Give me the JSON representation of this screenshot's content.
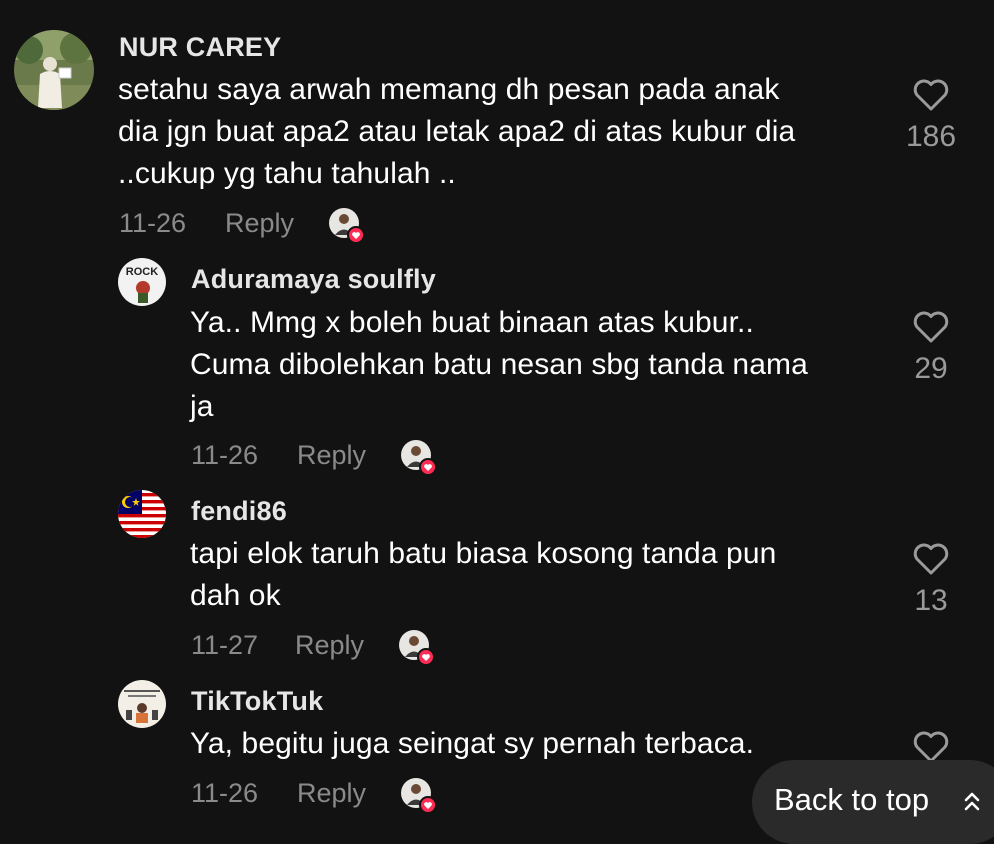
{
  "comments": [
    {
      "username": "NUR CAREY",
      "text_lines": [
        "setahu saya arwah memang dh pesan pada anak",
        "dia jgn buat apa2 atau letak apa2 di atas kubur dia",
        "..cukup yg tahu tahulah .."
      ],
      "date": "11-26",
      "reply_label": "Reply",
      "likes": "186"
    },
    {
      "username": "Aduramaya soulfly",
      "text_lines": [
        "Ya.. Mmg x boleh buat binaan atas kubur..",
        "Cuma dibolehkan batu nesan sbg tanda nama",
        "ja"
      ],
      "date": "11-26",
      "reply_label": "Reply",
      "likes": "29"
    },
    {
      "username": "fendi86",
      "text_lines": [
        "tapi elok taruh batu biasa kosong tanda pun",
        "dah ok"
      ],
      "date": "11-27",
      "reply_label": "Reply",
      "likes": "13"
    },
    {
      "username": "TikTokTuk",
      "text_lines": [
        "Ya, begitu juga seingat sy pernah terbaca."
      ],
      "date": "11-26",
      "reply_label": "Reply",
      "likes": ""
    }
  ],
  "back_to_top": {
    "label": "Back to top",
    "icon": "double-chevron-up-icon"
  },
  "icons": {
    "like": "heart-outline-icon",
    "creator_liked": "creator-liked-heart-icon"
  },
  "colors": {
    "background": "#121212",
    "muted_text": "#8a8a8a",
    "like_badge": "#fe2c55"
  }
}
